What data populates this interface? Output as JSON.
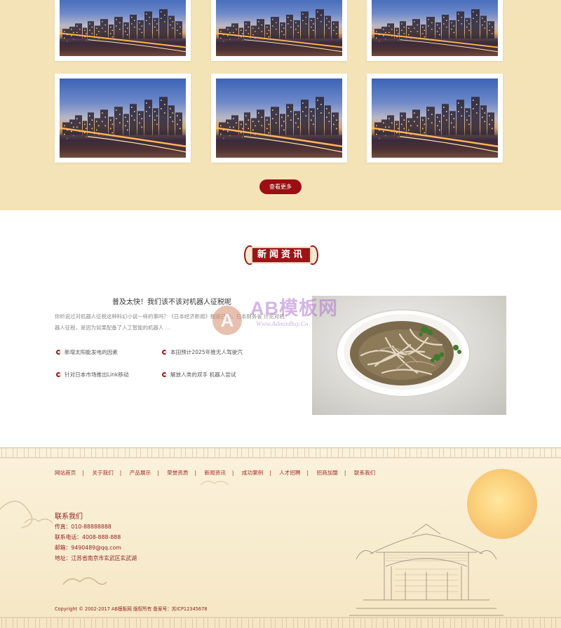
{
  "gallery": {
    "more_button": "查看更多",
    "photo_icon": "city-skyline-photo"
  },
  "news": {
    "section_title": "新闻资讯",
    "headline": "普及太快！我们该不该对机器人征税呢",
    "summary": "你听说过对机器人征税这种科幻小说一样的事吗？《日本经济新闻》报道日前，日本财务省 计论对机器人征税，是因为如果配备了人工智能的机器人 ...",
    "items": [
      "新增太阳能发电的因素",
      "本田预计2025年推无人驾驶汽",
      "针对日本市场推出Link移动",
      "解放人类的双手 机器人尝试"
    ],
    "photo_icon": "noodle-soup-photo",
    "accent_color": "#9b1518"
  },
  "watermark": {
    "logo_letter": "A",
    "brand": "AB模板网",
    "url": "Www.AdminBuy.Cn"
  },
  "footer": {
    "nav": [
      "网站首页",
      "关于我们",
      "产品展示",
      "荣誉资质",
      "新闻资讯",
      "成功案例",
      "人才招聘",
      "招商加盟",
      "联系我们"
    ],
    "contact_title": "联系我们",
    "fax": "传真：010-88888888",
    "phone": "联系电话：4008-888-888",
    "email": "邮箱：9490489@qq.com",
    "address": "地址：江苏省南京市玄武区玄武湖",
    "copyright": "Copyright © 2002-2017 AB模板网 版权所有 备案号：苏ICP12345678"
  }
}
